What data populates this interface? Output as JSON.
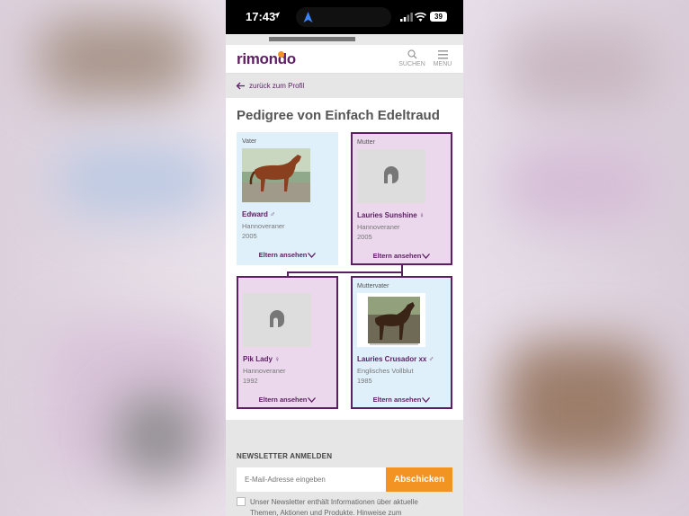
{
  "status_bar": {
    "time": "17:43",
    "battery": "39"
  },
  "header": {
    "logo": "rimondo",
    "search_label": "SUCHEN",
    "menu_label": "MENU"
  },
  "back_link": {
    "label": "zurück zum Profil"
  },
  "page_title": "Pedigree von Einfach Edeltraud",
  "pedigree": [
    {
      "role": "Vater",
      "name": "Edward",
      "sex": "♂",
      "breed": "Hannoveraner",
      "year": "2005",
      "action": "Eltern ansehen"
    },
    {
      "role": "Mutter",
      "name": "Lauries Sunshine",
      "sex": "♀",
      "breed": "Hannoveraner",
      "year": "2005",
      "action": "Eltern ansehen"
    },
    {
      "role": "",
      "name": "Pik Lady",
      "sex": "♀",
      "breed": "Hannoveraner",
      "year": "1992",
      "action": "Eltern ansehen"
    },
    {
      "role": "Muttervater",
      "name": "Lauries Crusador xx",
      "sex": "♂",
      "breed": "Englisches Vollblut",
      "year": "1985",
      "action": "Eltern ansehen"
    }
  ],
  "newsletter": {
    "title": "NEWSLETTER ANMELDEN",
    "placeholder": "E-Mail-Adresse eingeben",
    "button": "Abschicken",
    "consent": "Unser Newsletter enthält Informationen über aktuelle Themen, Aktionen und Produkte. Hinweise zum"
  },
  "colors": {
    "brand": "#5d1e63",
    "accent": "#f39323",
    "card_blue": "#dff0fb",
    "card_purple": "#ebd8ec"
  }
}
